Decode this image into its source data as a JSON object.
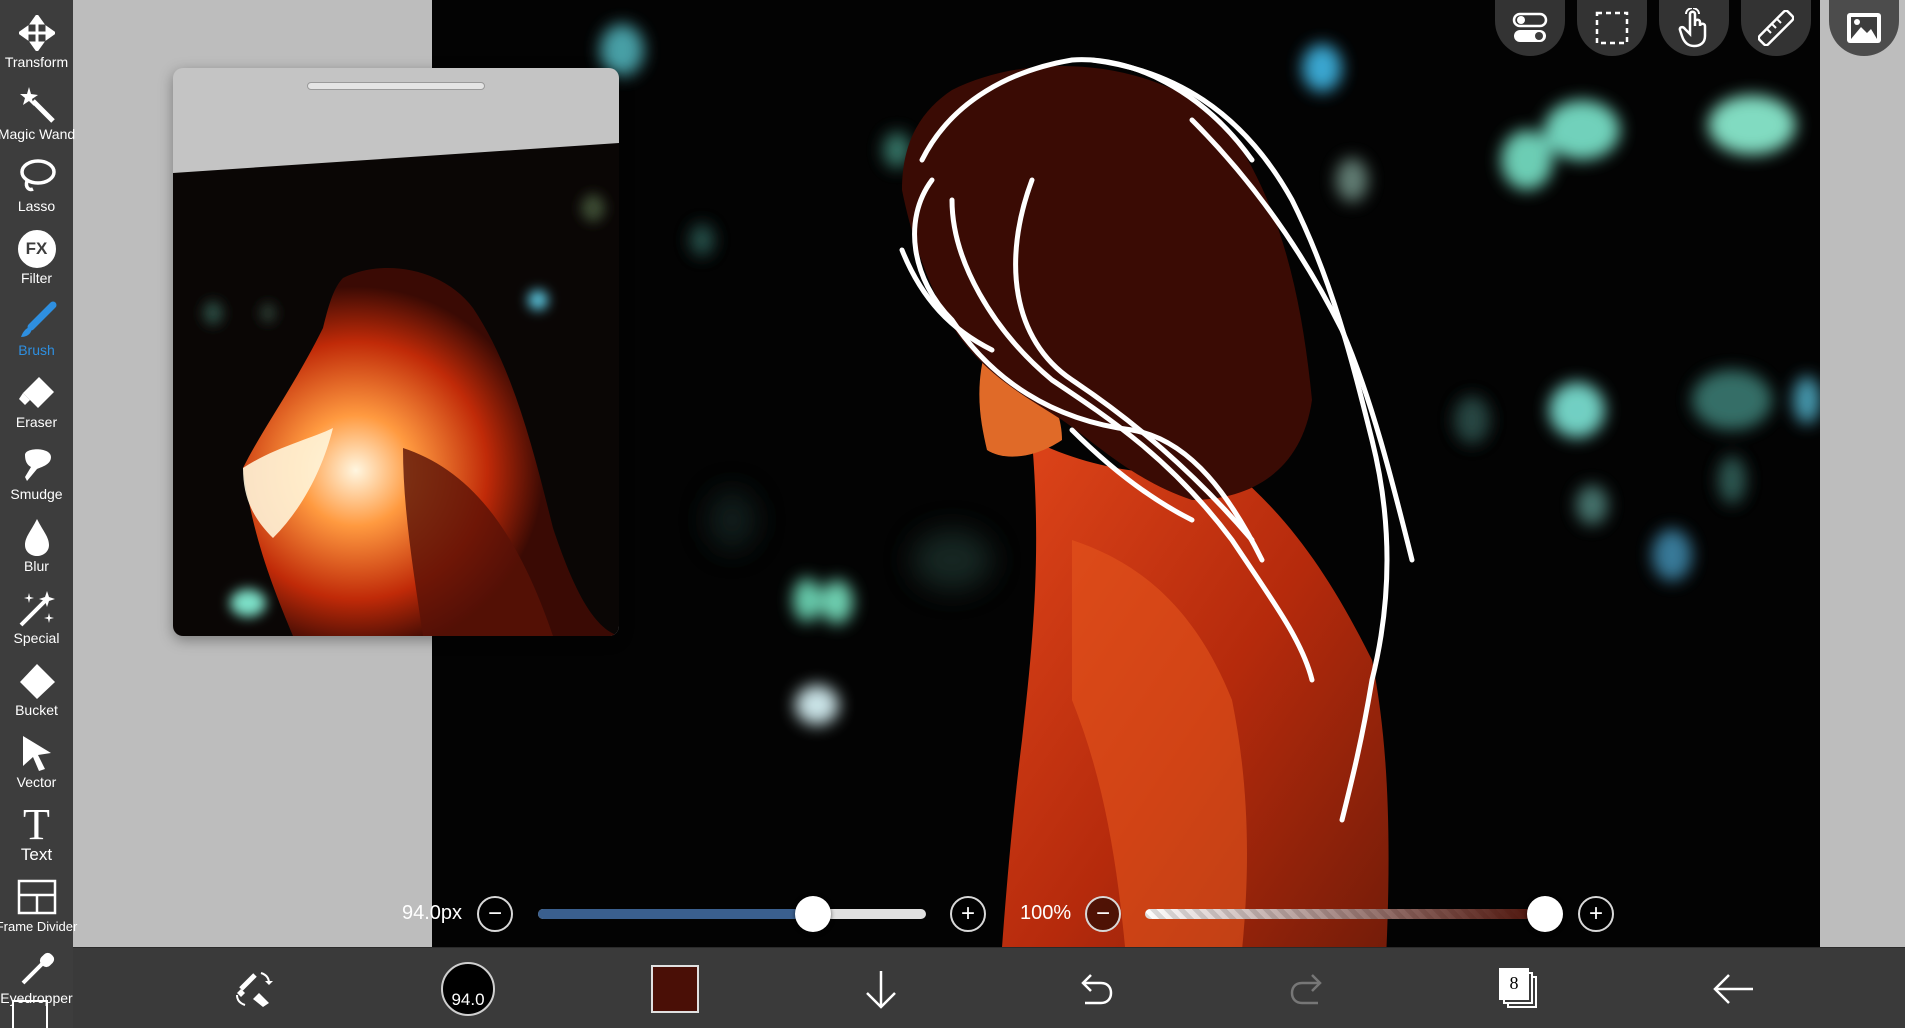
{
  "sidebar": {
    "tools": [
      {
        "label": "Transform",
        "icon": "transform-icon"
      },
      {
        "label": "Magic Wand",
        "icon": "magic-wand-icon"
      },
      {
        "label": "Lasso",
        "icon": "lasso-icon"
      },
      {
        "label": "Filter",
        "icon": "fx-icon",
        "glyph": "FX"
      },
      {
        "label": "Brush",
        "icon": "brush-icon",
        "active": true
      },
      {
        "label": "Eraser",
        "icon": "eraser-icon"
      },
      {
        "label": "Smudge",
        "icon": "smudge-icon"
      },
      {
        "label": "Blur",
        "icon": "blur-drop-icon"
      },
      {
        "label": "Special",
        "icon": "special-sparkle-icon"
      },
      {
        "label": "Bucket",
        "icon": "bucket-icon"
      },
      {
        "label": "Vector",
        "icon": "vector-arrow-icon"
      },
      {
        "label": "Text",
        "icon": "text-t-icon",
        "glyph": "T"
      },
      {
        "label": "Frame Divider",
        "icon": "frame-divider-icon"
      },
      {
        "label": "Eyedropper",
        "icon": "eyedropper-icon"
      }
    ]
  },
  "brush_size": {
    "value_text": "94.0px",
    "fraction": 0.71,
    "minus": "−",
    "plus": "+"
  },
  "opacity": {
    "value_text": "100%",
    "fraction": 1.0,
    "minus": "−",
    "plus": "+"
  },
  "bottom_bar": {
    "brush_preview_text": "94.0",
    "current_color": "#4a0f06",
    "layers_count": "8"
  },
  "colors": {
    "accent": "#2e8fe0",
    "sidebar_bg": "#3d3d3d",
    "bottom_bar_bg": "#3a3a3a",
    "brush_track": "#3a5f8e"
  }
}
